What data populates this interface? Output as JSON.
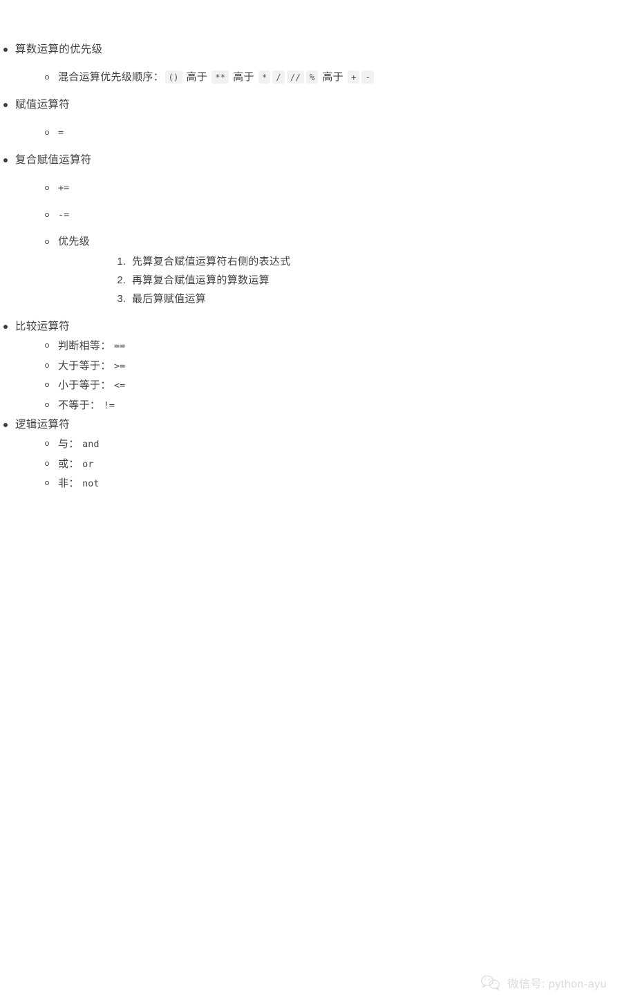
{
  "document": {
    "sections": [
      {
        "heading": "算数运算的优先级",
        "sub_items": [
          {
            "style": "loose",
            "label": "混合运算优先级顺序：",
            "sequence": [
              {
                "type": "chip",
                "text": "()"
              },
              {
                "type": "text",
                "text": "高于"
              },
              {
                "type": "chip",
                "text": "**"
              },
              {
                "type": "text",
                "text": "高于"
              },
              {
                "type": "chip",
                "text": "*"
              },
              {
                "type": "chip",
                "text": "/"
              },
              {
                "type": "chip",
                "text": "//"
              },
              {
                "type": "chip",
                "text": "%"
              },
              {
                "type": "text",
                "text": "高于"
              },
              {
                "type": "chip",
                "text": "+"
              },
              {
                "type": "chip",
                "text": "-"
              }
            ]
          }
        ]
      },
      {
        "heading": "赋值运算符",
        "sub_items": [
          {
            "style": "loose",
            "label": "",
            "code": "="
          }
        ]
      },
      {
        "heading": "复合赋值运算符",
        "sub_items": [
          {
            "style": "loose",
            "label": "",
            "code": "+="
          },
          {
            "style": "loose",
            "label": "",
            "code": "-="
          },
          {
            "style": "loose",
            "label": "优先级",
            "ordered": [
              "先算复合赋值运算符右侧的表达式",
              "再算复合赋值运算的算数运算",
              "最后算赋值运算"
            ]
          }
        ]
      },
      {
        "heading": "比较运算符",
        "sub_items": [
          {
            "style": "tight",
            "label": "判断相等：",
            "code": "=="
          },
          {
            "style": "tight",
            "label": "大于等于：",
            "code": ">="
          },
          {
            "style": "tight",
            "label": "小于等于：",
            "code": "<="
          },
          {
            "style": "tight",
            "label": "不等于：",
            "code": "!="
          }
        ]
      },
      {
        "heading": "逻辑运算符",
        "sub_items": [
          {
            "style": "tight",
            "label": "与：",
            "code": "and"
          },
          {
            "style": "tight",
            "label": "或：",
            "code": "or"
          },
          {
            "style": "tight",
            "label": "非：",
            "code": "not"
          }
        ]
      }
    ]
  },
  "footer": {
    "icon": "wechat-icon",
    "text": "微信号: python-ayu"
  },
  "colors": {
    "text": "#3f3f3f",
    "code": "#4a4a4a",
    "chip_background": "#f2f2f2",
    "footer": "#dadada",
    "page_background": "#ffffff"
  }
}
